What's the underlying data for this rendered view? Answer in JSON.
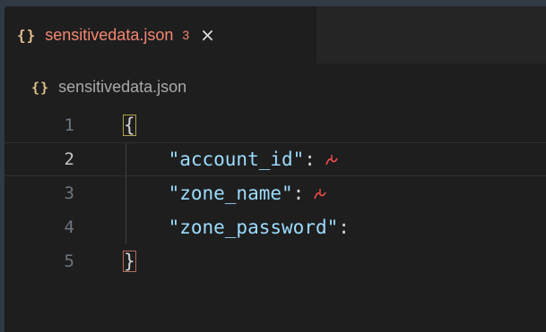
{
  "tab": {
    "icon": "{}",
    "filename": "sensitivedata.json",
    "problem_count": "3",
    "close_glyph": "×"
  },
  "breadcrumb": {
    "icon": "{}",
    "filename": "sensitivedata.json"
  },
  "editor": {
    "active_line": 2,
    "lines": [
      {
        "number": "1",
        "text": "{"
      },
      {
        "number": "2",
        "key": "\"account_id\"",
        "colon": ":"
      },
      {
        "number": "3",
        "key": "\"zone_name\"",
        "colon": ":"
      },
      {
        "number": "4",
        "key": "\"zone_password\"",
        "colon": ":"
      },
      {
        "number": "5",
        "text": "}"
      }
    ]
  },
  "colors": {
    "editor_bg": "#1e1e1e",
    "error_text": "#f48771",
    "json_key": "#9cdcfe",
    "json_icon": "#e2c08d",
    "error_squiggle": "#f14c4c"
  }
}
